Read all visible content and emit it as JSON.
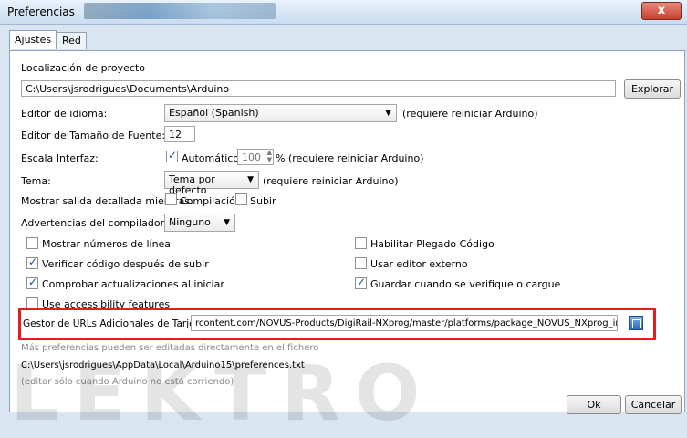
{
  "window": {
    "title": "Preferencias",
    "close_label": "x"
  },
  "tabs": [
    {
      "label": "Ajustes"
    },
    {
      "label": "Red"
    }
  ],
  "sketchbook": {
    "label": "Localización de proyecto",
    "value": "C:\\Users\\jsrodrigues\\Documents\\Arduino",
    "browse_label": "Explorar"
  },
  "language": {
    "label": "Editor de idioma:",
    "value": "Español (Spanish)",
    "note": "(requiere reiniciar Arduino)"
  },
  "font_size": {
    "label": "Editor de Tamaño de Fuente:",
    "value": "12"
  },
  "scale": {
    "label": "Escala Interfaz:",
    "auto_label": "Automático",
    "auto_checked": true,
    "value": "100",
    "suffix": "% (requiere reiniciar Arduino)"
  },
  "theme": {
    "label": "Tema:",
    "value": "Tema por defecto",
    "note": "(requiere reiniciar Arduino)"
  },
  "verbose": {
    "label": "Mostrar salida detallada mientras:",
    "compile_label": "Compilación",
    "compile_checked": false,
    "upload_label": "Subir",
    "upload_checked": false
  },
  "warnings": {
    "label": "Advertencias del compilador:",
    "value": "Ninguno"
  },
  "options": {
    "line_numbers": {
      "label": "Mostrar números de línea",
      "checked": false
    },
    "verify_upload": {
      "label": "Verificar código después de subir",
      "checked": true
    },
    "check_updates": {
      "label": "Comprobar actualizaciones al iniciar",
      "checked": true
    },
    "accessibility": {
      "label": "Use accessibility features",
      "checked": false
    },
    "code_folding": {
      "label": "Habilitar Plegado Código",
      "checked": false
    },
    "external_editor": {
      "label": "Usar editor externo",
      "checked": false
    },
    "save_on_verify": {
      "label": "Guardar cuando se verifique o cargue",
      "checked": true
    }
  },
  "board_urls": {
    "label": "Gestor de URLs Adicionales de Tarjetas:",
    "value": "rcontent.com/NOVUS-Products/DigiRail-NXprog/master/platforms/package_NOVUS_NXprog_index.json"
  },
  "more_prefs": "Más preferencias pueden ser editadas directamente en el fichero",
  "prefs_path": "C:\\Users\\jsrodrigues\\AppData\\Local\\Arduino15\\preferences.txt",
  "edit_note": "(editar sólo cuando Arduino no está corriendo)",
  "buttons": {
    "ok": "Ok",
    "cancel": "Cancelar"
  },
  "watermark": "LEKTRO",
  "colors": {
    "highlight": "#e41d1d"
  }
}
